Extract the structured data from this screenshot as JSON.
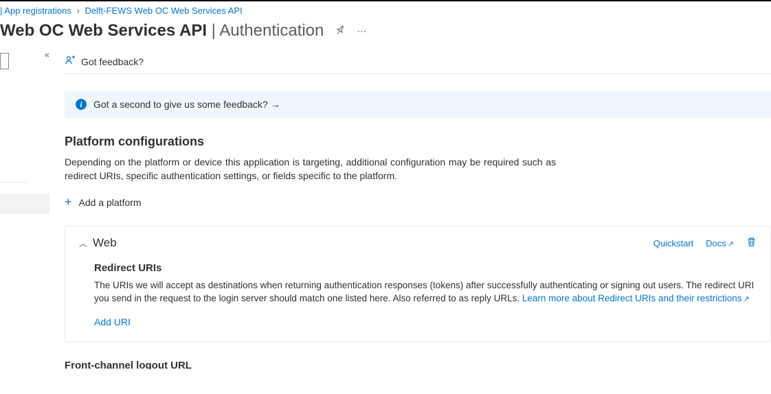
{
  "breadcrumbs": {
    "item1": "App registrations",
    "item2": "Delft-FEWS Web OC Web Services API"
  },
  "title": {
    "main": "Web OC Web Services API",
    "sep": " | ",
    "sub": "Authentication"
  },
  "feedback": {
    "label": "Got feedback?"
  },
  "banner": {
    "text": "Got a second to give us some feedback?"
  },
  "platform": {
    "heading": "Platform configurations",
    "desc": "Depending on the platform or device this application is targeting, additional configuration may be required such as redirect URIs, specific authentication settings, or fields specific to the platform.",
    "add": "Add a platform"
  },
  "web_card": {
    "name": "Web",
    "quickstart": "Quickstart",
    "docs": "Docs",
    "redirect_heading": "Redirect URIs",
    "redirect_desc_1": "The URIs we will accept as destinations when returning authentication responses (tokens) after successfully authenticating or signing out users. The redirect URI you send in the request to the login server should match one listed here. Also referred to as reply URLs. ",
    "redirect_link": "Learn more about Redirect URIs and their restrictions",
    "add_uri": "Add URI"
  },
  "cutoff": "Front-channel logout URL"
}
